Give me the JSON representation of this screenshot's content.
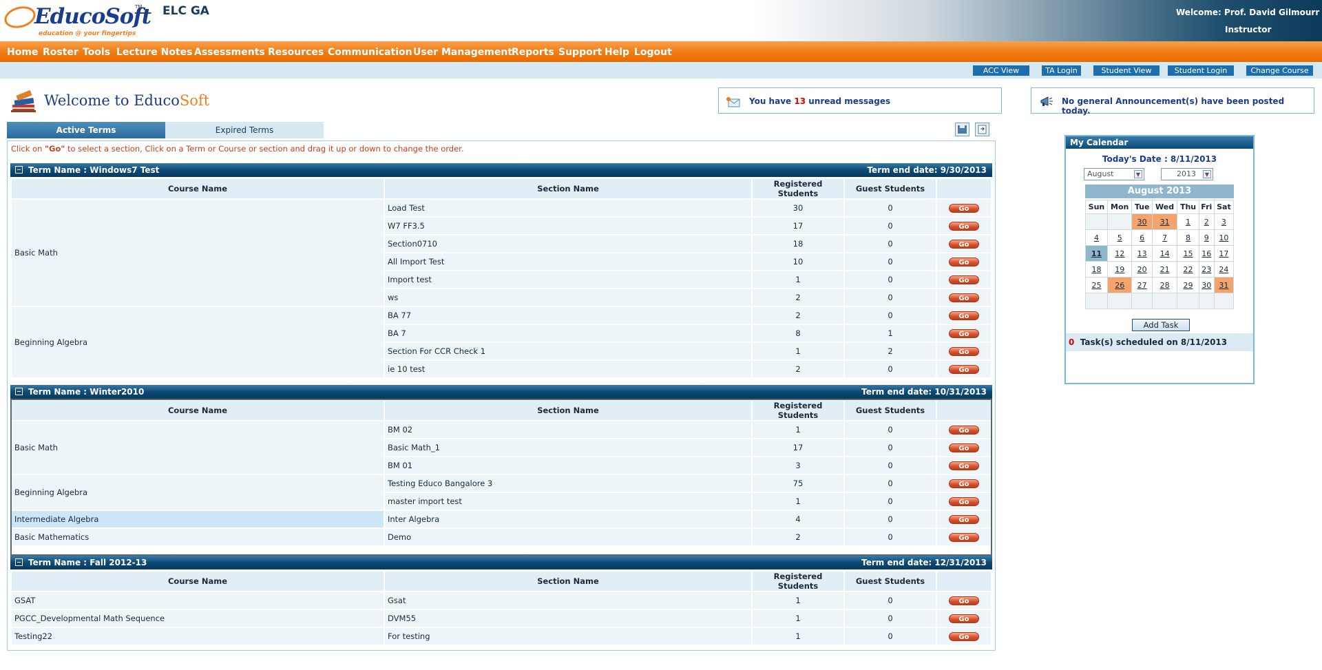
{
  "header": {
    "logo_text": "EducoSoft",
    "logo_tm": "TM",
    "logo_tagline": "education @ your fingertips",
    "site_name": "ELC GA",
    "welcome": "Welcome: Prof. David Gilmourr",
    "role": "Instructor"
  },
  "nav": [
    "Home",
    "Roster",
    "Tools",
    "Lecture Notes",
    "Assessments",
    "Resources",
    "Communication",
    "User Management",
    "Reports",
    "Support",
    "Help",
    "Logout"
  ],
  "subnav": [
    "ACC View",
    "TA Login",
    "Student View",
    "Student Login",
    "Change Course"
  ],
  "page_title": {
    "main": "Welcome to Educo",
    "accent": "Soft"
  },
  "messages": {
    "prefix": "You have",
    "count": "13",
    "suffix": "unread messages"
  },
  "announcement": "No general Announcement(s) have been posted today.",
  "tabs": {
    "active": "Active Terms",
    "expired": "Expired Terms"
  },
  "instruction": {
    "a": "Click on ",
    "b": "\"Go\"",
    "c": " to select a section, Click on a Term or Course or section and drag it up or down to change the order."
  },
  "columns": {
    "course": "Course Name",
    "section": "Section Name",
    "registered": "Registered Students",
    "guest": "Guest Students"
  },
  "go_label": "Go",
  "terms": [
    {
      "name": "Term Name : Windows7 Test",
      "end": "Term end date: 9/30/2013",
      "courses": [
        {
          "name": "Basic Math",
          "sections": [
            [
              "Load Test",
              "30",
              "0"
            ],
            [
              "W7 FF3.5",
              "17",
              "0"
            ],
            [
              "Section0710",
              "18",
              "0"
            ],
            [
              "All Import Test",
              "10",
              "0"
            ],
            [
              "Import test",
              "1",
              "0"
            ],
            [
              "ws",
              "2",
              "0"
            ]
          ]
        },
        {
          "name": "Beginning Algebra",
          "sections": [
            [
              "BA 77",
              "2",
              "0"
            ],
            [
              "BA 7",
              "8",
              "1"
            ],
            [
              "Section For CCR Check 1",
              "1",
              "2"
            ],
            [
              "ie 10 test",
              "2",
              "0"
            ]
          ]
        }
      ]
    },
    {
      "name": "Term Name : Winter2010",
      "end": "Term end date: 10/31/2013",
      "courses": [
        {
          "name": "Basic Math",
          "sections": [
            [
              "BM 02",
              "1",
              "0"
            ],
            [
              "Basic Math_1",
              "17",
              "0"
            ],
            [
              "BM 01",
              "3",
              "0"
            ]
          ]
        },
        {
          "name": "Beginning Algebra",
          "sections": [
            [
              "Testing Educo Bangalore 3",
              "75",
              "0"
            ],
            [
              "master import test",
              "1",
              "0"
            ]
          ]
        },
        {
          "name": "Intermediate Algebra",
          "sections": [
            [
              "Inter Algebra",
              "4",
              "0"
            ]
          ]
        },
        {
          "name": "Basic Mathematics",
          "sections": [
            [
              "Demo",
              "2",
              "0"
            ]
          ]
        }
      ]
    },
    {
      "name": "Term Name : Fall 2012-13",
      "end": "Term end date: 12/31/2013",
      "courses": [
        {
          "name": "GSAT",
          "sections": [
            [
              "Gsat",
              "1",
              "0"
            ]
          ]
        },
        {
          "name": "PGCC_Developmental Math Sequence",
          "sections": [
            [
              "DVM55",
              "1",
              "0"
            ]
          ]
        },
        {
          "name": "Testing22",
          "sections": [
            [
              "For testing",
              "1",
              "0"
            ]
          ]
        }
      ]
    }
  ],
  "calendar": {
    "title": "My Calendar",
    "today": "Today's Date : 8/11/2013",
    "month_select": "August",
    "year_select": "2013",
    "month_header": "August 2013",
    "days": [
      "Sun",
      "Mon",
      "Tue",
      "Wed",
      "Thu",
      "Fri",
      "Sat"
    ],
    "weeks": [
      [
        "",
        "",
        "30",
        "31",
        "1",
        "2",
        "3"
      ],
      [
        "4",
        "5",
        "6",
        "7",
        "8",
        "9",
        "10"
      ],
      [
        "11",
        "12",
        "13",
        "14",
        "15",
        "16",
        "17"
      ],
      [
        "18",
        "19",
        "20",
        "21",
        "22",
        "23",
        "24"
      ],
      [
        "25",
        "26",
        "27",
        "28",
        "29",
        "30",
        "31"
      ],
      [
        "",
        "",
        "",
        "",
        "",
        "",
        ""
      ]
    ],
    "add_task": "Add Task",
    "tasks_count": "0",
    "tasks_text": "Task(s) scheduled on  8/11/2013"
  },
  "colors": {
    "brand_blue": "#1a3c8c",
    "orange": "#f07b12",
    "term_bar": "#0d4a76",
    "go_button": "#d9522c"
  }
}
